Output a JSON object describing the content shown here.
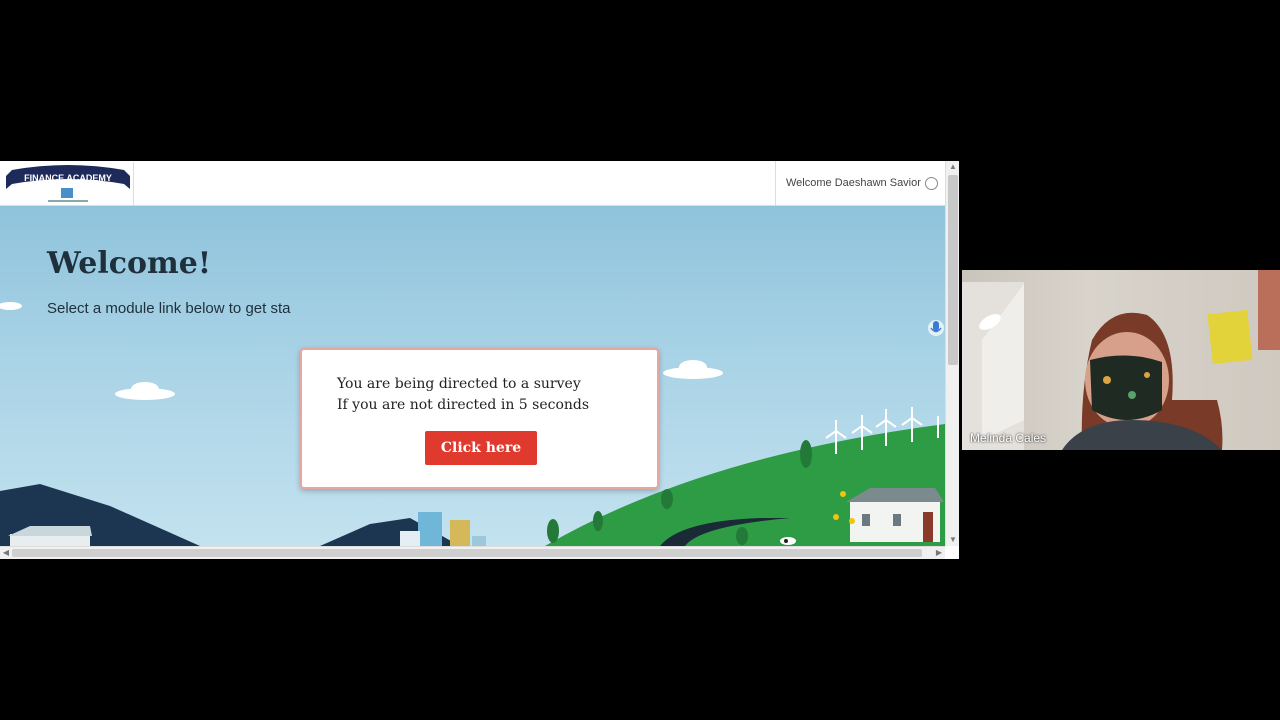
{
  "app": {
    "logo_text": "FINANCE ACADEMY",
    "welcome_user": "Welcome Daeshawn Savior"
  },
  "hero": {
    "title": "Welcome!",
    "subtitle": "Select a module link below to get sta"
  },
  "modal": {
    "line1": "You are being directed to a survey",
    "line2": "If you are not directed in 5 seconds",
    "button_label": "Click here"
  },
  "participant": {
    "name": "Melinda Cales"
  },
  "colors": {
    "brand_navy": "#1e2a5a",
    "button_red": "#e03a2f",
    "hill_green": "#2e9b45",
    "sky": "#a9d3e6"
  },
  "icons": [
    "user-icon",
    "microphone-icon"
  ]
}
